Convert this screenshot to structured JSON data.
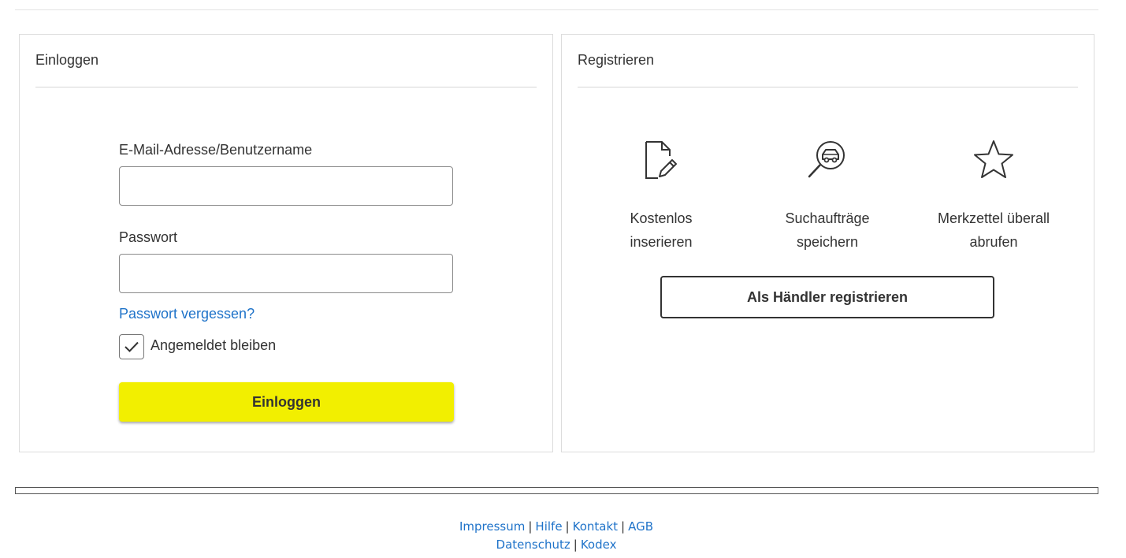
{
  "login": {
    "title": "Einloggen",
    "email_label": "E-Mail-Adresse/Benutzername",
    "email_value": "",
    "password_label": "Passwort",
    "password_value": "",
    "forgot_link": "Passwort vergessen?",
    "remember_label": "Angemeldet bleiben",
    "remember_checked": true,
    "submit_label": "Einloggen",
    "submit_color": "#f2ef00"
  },
  "register": {
    "title": "Registrieren",
    "features": [
      {
        "icon": "document-edit-icon",
        "text": "Kostenlos\ninserieren"
      },
      {
        "icon": "car-search-icon",
        "text": "Suchaufträge\nspeichern"
      },
      {
        "icon": "star-icon",
        "text": "Merkzettel überall\nabrufen"
      }
    ],
    "dealer_button": "Als Händler registrieren"
  },
  "footer": {
    "row1": [
      "Impressum",
      "Hilfe",
      "Kontakt",
      "AGB"
    ],
    "row2": [
      "Datenschutz",
      "Kodex"
    ],
    "separator": "|"
  },
  "colors": {
    "link": "#1f73c9",
    "text": "#333333"
  }
}
